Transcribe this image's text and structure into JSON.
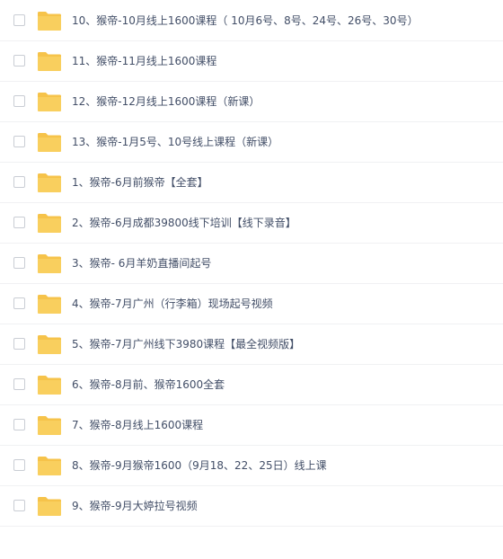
{
  "folder_color": "#f6c34a",
  "folder_icon_name": "folder-icon",
  "files": [
    {
      "name": "10、猴帝-10月线上1600课程（ 10月6号、8号、24号、26号、30号）"
    },
    {
      "name": "11、猴帝-11月线上1600课程"
    },
    {
      "name": "12、猴帝-12月线上1600课程（新课）"
    },
    {
      "name": "13、猴帝-1月5号、10号线上课程（新课）"
    },
    {
      "name": "1、猴帝-6月前猴帝【全套】"
    },
    {
      "name": "2、猴帝-6月成都39800线下培训【线下录音】"
    },
    {
      "name": "3、猴帝- 6月羊奶直播间起号"
    },
    {
      "name": "4、猴帝-7月广州（行李箱）现场起号视频"
    },
    {
      "name": "5、猴帝-7月广州线下3980课程【最全视频版】"
    },
    {
      "name": "6、猴帝-8月前、猴帝1600全套"
    },
    {
      "name": "7、猴帝-8月线上1600课程"
    },
    {
      "name": "8、猴帝-9月猴帝1600（9月18、22、25日）线上课"
    },
    {
      "name": "9、猴帝-9月大婷拉号视频"
    }
  ]
}
